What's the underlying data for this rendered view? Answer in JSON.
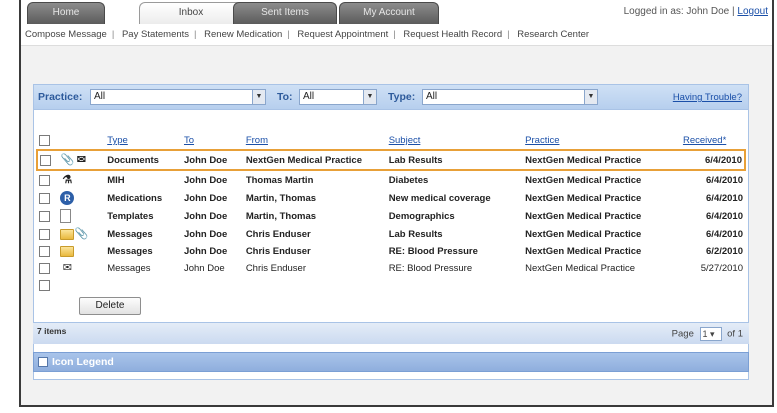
{
  "tabs": [
    {
      "label": "Home",
      "active": false
    },
    {
      "label": "Inbox",
      "active": true
    },
    {
      "label": "Sent Items",
      "active": false
    },
    {
      "label": "My Account",
      "active": false
    }
  ],
  "login": {
    "text": "Logged in as: John Doe |",
    "logout_label": "Logout"
  },
  "subnav": [
    "Compose Message",
    "Pay Statements",
    "Renew Medication",
    "Request Appointment",
    "Request Health Record",
    "Research Center"
  ],
  "filters": {
    "practice_label": "Practice:",
    "practice_value": "All",
    "to_label": "To:",
    "to_value": "All",
    "type_label": "Type:",
    "type_value": "All",
    "trouble_link": "Having Trouble?"
  },
  "table": {
    "columns": [
      "Type",
      "To",
      "From",
      "Subject",
      "Practice",
      "Received"
    ],
    "sort_indicator": "*",
    "rows": [
      {
        "icon": "document-icon",
        "type": "Documents",
        "to": "John Doe",
        "from": "NextGen Medical Practice",
        "subject": "Lab Results",
        "practice": "NextGen Medical Practice",
        "received": "6/4/2010",
        "bold": true,
        "highlighted": true
      },
      {
        "icon": "pill-icon",
        "type": "MIH",
        "to": "John Doe",
        "from": "Thomas Martin",
        "subject": "Diabetes",
        "practice": "NextGen Medical Practice",
        "received": "6/4/2010",
        "bold": true,
        "highlighted": false
      },
      {
        "icon": "medication-icon",
        "type": "Medications",
        "to": "John Doe",
        "from": "Martin, Thomas",
        "subject": "New medical coverage",
        "practice": "NextGen Medical Practice",
        "received": "6/4/2010",
        "bold": true,
        "highlighted": false
      },
      {
        "icon": "template-icon",
        "type": "Templates",
        "to": "John Doe",
        "from": "Martin, Thomas",
        "subject": "Demographics",
        "practice": "NextGen Medical Practice",
        "received": "6/4/2010",
        "bold": true,
        "highlighted": false
      },
      {
        "icon": "folder-icon",
        "type": "Messages",
        "to": "John Doe",
        "from": "Chris Enduser",
        "subject": "Lab Results",
        "practice": "NextGen Medical Practice",
        "received": "6/4/2010",
        "bold": true,
        "highlighted": false
      },
      {
        "icon": "folder-icon",
        "type": "Messages",
        "to": "John Doe",
        "from": "Chris Enduser",
        "subject": "RE: Blood Pressure",
        "practice": "NextGen Medical Practice",
        "received": "6/2/2010",
        "bold": true,
        "highlighted": false
      },
      {
        "icon": "open-envelope-icon",
        "type": "Messages",
        "to": "John Doe",
        "from": "Chris Enduser",
        "subject": "RE: Blood Pressure",
        "practice": "NextGen Medical Practice",
        "received": "5/27/2010",
        "bold": false,
        "highlighted": false
      }
    ]
  },
  "delete_label": "Delete",
  "footer": {
    "items_text": "7 items",
    "page_label": "Page",
    "page_value": "1",
    "of_text": "of 1"
  },
  "legend_label": "Icon Legend"
}
